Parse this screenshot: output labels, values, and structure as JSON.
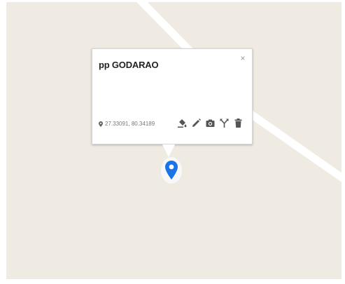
{
  "map": {
    "background_color": "#efebe2",
    "road_color": "#ffffff"
  },
  "popup": {
    "title": "pp GODARAO",
    "close_label": "×",
    "coordinates": "27.33091, 80.34189",
    "actions": [
      {
        "name": "paint-bucket-icon",
        "label": "Style"
      },
      {
        "name": "pencil-icon",
        "label": "Edit"
      },
      {
        "name": "camera-icon",
        "label": "Add image"
      },
      {
        "name": "route-icon",
        "label": "Directions"
      },
      {
        "name": "trash-icon",
        "label": "Delete"
      }
    ]
  },
  "marker": {
    "color": "#1a73e8",
    "icon": "map-pin-icon"
  }
}
